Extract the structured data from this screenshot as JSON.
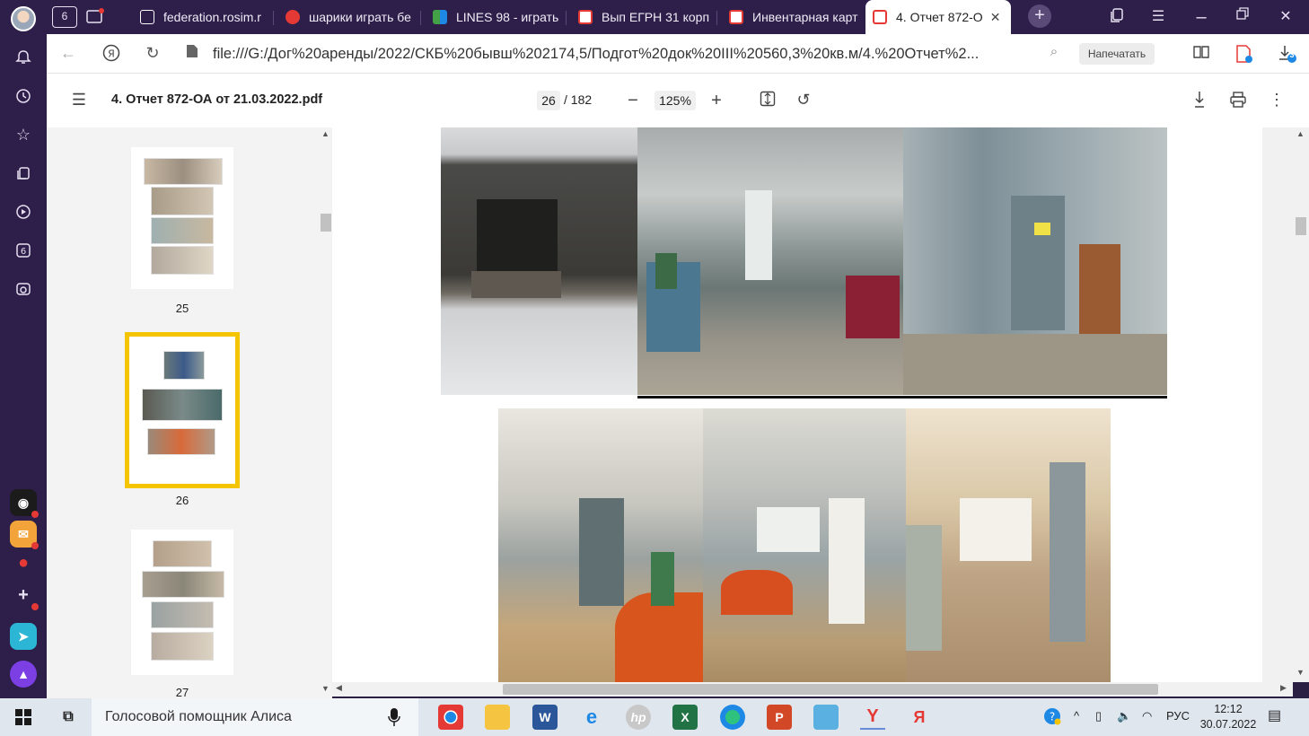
{
  "tabs": [
    {
      "label": "federation.rosim.r",
      "fav_color": "#ffffff"
    },
    {
      "label": "шарики играть бе",
      "fav_color": "#e53935"
    },
    {
      "label": "LINES 98 - играть",
      "fav_color": "#43a047"
    },
    {
      "label": "Вып ЕГРН 31 корп",
      "fav_color": "#e53935"
    },
    {
      "label": "Инвентарная карт",
      "fav_color": "#e53935"
    },
    {
      "label": "4. Отчет 872-О",
      "fav_color": "#e53935"
    }
  ],
  "tab_counter": "6",
  "address": {
    "url": "file:///G:/Дог%20аренды/2022/СКБ%20бывш%202174,5/Подгот%20док%20III%20560,3%20кв.м/4.%20Отчет%2...",
    "print_label": "Напечатать",
    "downloads_badge": "3"
  },
  "pdf": {
    "filename": "4. Отчет 872-ОА от 21.03.2022.pdf",
    "current_page": "26",
    "total_pages": "/ 182",
    "zoom": "125%"
  },
  "thumbnails": [
    {
      "label": "25",
      "selected": false
    },
    {
      "label": "26",
      "selected": true
    },
    {
      "label": "27",
      "selected": false
    }
  ],
  "taskbar": {
    "assistant_label": "Голосовой помощник Алиса",
    "language": "РУС",
    "time": "12:12",
    "date": "30.07.2022"
  },
  "colors": {
    "sidebar_bg": "#2d1e4a",
    "selected_thumb_border": "#f5c400",
    "accent_red": "#e53935"
  }
}
